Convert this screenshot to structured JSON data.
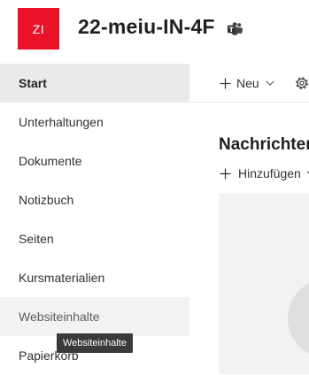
{
  "site": {
    "logo_initials": "ZI",
    "title": "22-meiu-IN-4F",
    "logo_color": "#e8132b",
    "teams_icon": "teams-icon"
  },
  "sidebar": {
    "items": [
      {
        "label": "Start",
        "state": "selected"
      },
      {
        "label": "Unterhaltungen",
        "state": "normal"
      },
      {
        "label": "Dokumente",
        "state": "normal"
      },
      {
        "label": "Notizbuch",
        "state": "normal"
      },
      {
        "label": "Seiten",
        "state": "normal"
      },
      {
        "label": "Kursmaterialien",
        "state": "normal"
      },
      {
        "label": "Websiteinhalte",
        "state": "hover"
      },
      {
        "label": "Papierkorb",
        "state": "normal"
      }
    ],
    "tooltip": "Websiteinhalte"
  },
  "command_bar": {
    "new_label": "Neu",
    "new_icon": "plus-icon",
    "dropdown_icon": "chevron-down-icon",
    "settings_icon": "gear-icon"
  },
  "news": {
    "heading": "Nachrichten",
    "add_label": "Hinzufügen",
    "add_icon": "plus-icon"
  }
}
